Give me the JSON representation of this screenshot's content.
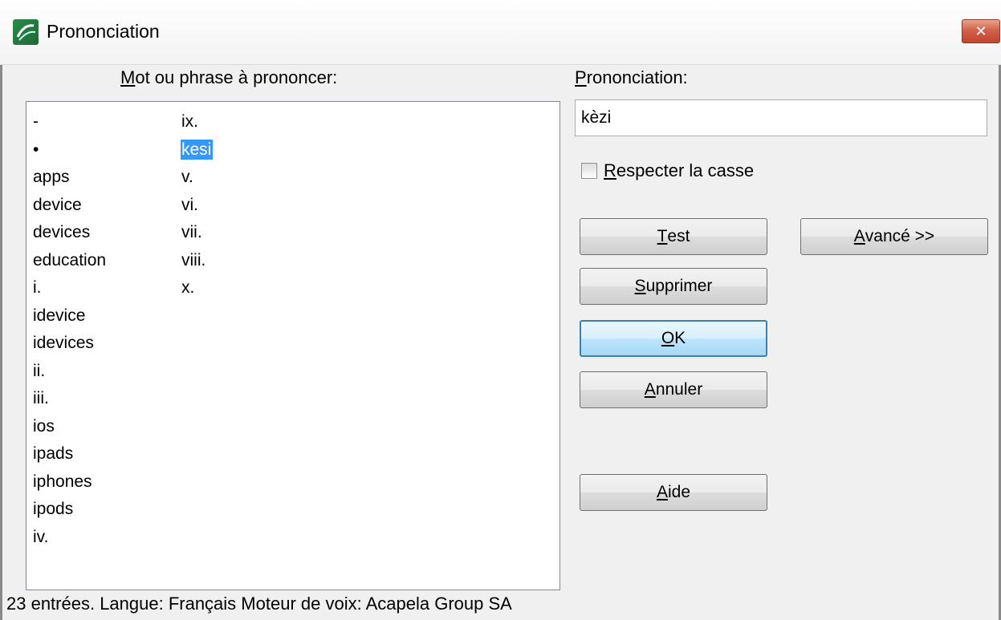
{
  "window": {
    "title": "Prononciation",
    "close_label": "✕"
  },
  "labels": {
    "words_prefix": "M",
    "words_rest": "ot ou phrase à prononcer:",
    "pron_prefix": "P",
    "pron_rest": "rononciation:"
  },
  "wordlist": {
    "col1": [
      "-",
      "•",
      "apps",
      "device",
      "devices",
      "education",
      "i.",
      "idevice",
      "idevices",
      "ii.",
      "iii.",
      "ios",
      "ipads",
      "iphones",
      "ipods",
      "iv."
    ],
    "col2": [
      "ix.",
      "kesi",
      "v.",
      "vi.",
      "vii.",
      "viii.",
      "x."
    ],
    "selected": "kesi"
  },
  "pronunciation": {
    "value": "kèzi"
  },
  "checkbox": {
    "prefix": "R",
    "rest": "especter la casse",
    "checked": false
  },
  "buttons": {
    "test": {
      "prefix": "T",
      "rest": "est"
    },
    "avance": {
      "prefix": "A",
      "rest": "vancé >>"
    },
    "supprimer": {
      "prefix": "S",
      "rest": "upprimer"
    },
    "ok": {
      "prefix": "O",
      "rest": "K"
    },
    "annuler": {
      "prefix": "A",
      "rest": "nnuler"
    },
    "aide": {
      "prefix": "A",
      "rest": "ide"
    }
  },
  "status": {
    "text": "23 entrées. Langue: Français Moteur de voix: Acapela Group SA"
  },
  "colors": {
    "selection": "#3399ff",
    "close_button": "#c1442e"
  }
}
